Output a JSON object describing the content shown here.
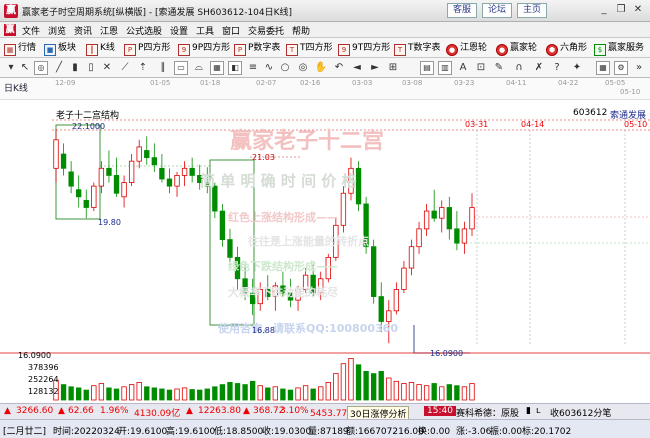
{
  "window": {
    "title": "赢家老子时空周期系统[纵横版] - [索通发展  SH603612-104日K线]",
    "buttons": [
      "客服",
      "论坛",
      "主页"
    ],
    "controls": [
      "minimize",
      "restore",
      "close"
    ]
  },
  "menu": {
    "items": [
      "文件",
      "浏览",
      "资讯",
      "江恩",
      "公式选股",
      "设置",
      "工具",
      "窗口",
      "交易委托",
      "帮助"
    ]
  },
  "toolbar1": {
    "items": [
      {
        "label": "行情",
        "icon": "grid-icon"
      },
      {
        "label": "板块",
        "icon": "block-icon"
      },
      {
        "label": "K线",
        "icon": "kline-icon"
      },
      {
        "label": "P四方形",
        "icon": "p-square-icon"
      },
      {
        "label": "9P四方形",
        "icon": "9p-square-icon"
      },
      {
        "label": "P数字表",
        "icon": "p-table-icon"
      },
      {
        "label": "T四方形",
        "icon": "t-square-icon"
      },
      {
        "label": "9T四方形",
        "icon": "9t-square-icon"
      },
      {
        "label": "T数字表",
        "icon": "t-table-icon"
      },
      {
        "label": "江恩轮",
        "icon": "gann-wheel-icon"
      },
      {
        "label": "赢家轮",
        "icon": "winner-wheel-icon"
      },
      {
        "label": "六角形",
        "icon": "hexagon-icon"
      },
      {
        "label": "赢家服务",
        "icon": "service-icon"
      }
    ]
  },
  "datebar": {
    "timeframe": "日K线",
    "dates": [
      "12-09",
      "01-05",
      "01-18",
      "02-07",
      "02-16",
      "03-03",
      "03-08",
      "03-23",
      "04-11",
      "04-22",
      "05-05",
      "05-10"
    ]
  },
  "chart": {
    "formula_name": "老子十二宫结构",
    "stock_code": "603612",
    "stock_name": "索通发展",
    "time_labels": [
      "03-31",
      "04-14",
      "05-10"
    ],
    "watermark_brand": "赢家老子十二宫",
    "watermark_motto": "简 单   明 确   时 间   价 格",
    "watermark_red": "红色上涨结构形成——",
    "watermark_red2": "往往是上涨能量的转折点",
    "watermark_green": "绿色下跌结构形成——",
    "watermark_green2": "大概率下跌动能的耗尽",
    "watermark_contact": "使用咨询，请联系QQ:100800360",
    "price_labels": [
      "22.1000",
      "19.80",
      "21.03",
      "16.88",
      "16.0900"
    ],
    "volume_axis": [
      "16.0900",
      "378396",
      "252264",
      "128132"
    ]
  },
  "chart_data": {
    "type": "candlestick",
    "candles": [
      [
        21.0,
        22.1,
        20.6,
        21.8
      ],
      [
        21.4,
        21.7,
        20.8,
        21.0
      ],
      [
        20.9,
        21.2,
        20.3,
        20.5
      ],
      [
        20.4,
        20.8,
        19.9,
        20.2
      ],
      [
        20.1,
        20.4,
        19.6,
        19.9
      ],
      [
        19.9,
        20.6,
        19.8,
        20.5
      ],
      [
        20.5,
        21.2,
        20.3,
        21.0
      ],
      [
        21.0,
        21.5,
        20.6,
        20.8
      ],
      [
        20.8,
        21.3,
        20.2,
        20.3
      ],
      [
        20.2,
        20.8,
        19.9,
        20.6
      ],
      [
        20.6,
        21.4,
        20.5,
        21.2
      ],
      [
        21.2,
        21.8,
        21.0,
        21.6
      ],
      [
        21.5,
        21.9,
        21.1,
        21.3
      ],
      [
        21.3,
        21.7,
        20.9,
        21.1
      ],
      [
        21.0,
        21.4,
        20.6,
        20.7
      ],
      [
        20.7,
        21.0,
        20.3,
        20.5
      ],
      [
        20.5,
        20.9,
        20.2,
        20.8
      ],
      [
        20.8,
        21.2,
        20.5,
        21.0
      ],
      [
        21.0,
        21.3,
        20.6,
        20.8
      ],
      [
        20.8,
        21.1,
        20.4,
        20.6
      ],
      [
        20.6,
        21.03,
        20.3,
        20.5
      ],
      [
        20.5,
        20.6,
        19.6,
        19.8
      ],
      [
        19.8,
        20.0,
        18.8,
        19.0
      ],
      [
        19.0,
        19.3,
        18.2,
        18.5
      ],
      [
        18.5,
        18.8,
        17.6,
        17.9
      ],
      [
        17.9,
        18.3,
        17.3,
        17.5
      ],
      [
        17.5,
        17.9,
        16.88,
        17.2
      ],
      [
        17.2,
        17.8,
        17.0,
        17.6
      ],
      [
        17.6,
        18.0,
        17.3,
        17.4
      ],
      [
        17.4,
        17.8,
        17.0,
        17.7
      ],
      [
        17.7,
        18.1,
        17.4,
        17.5
      ],
      [
        17.5,
        17.9,
        17.1,
        17.3
      ],
      [
        17.3,
        17.7,
        17.0,
        17.6
      ],
      [
        17.6,
        18.2,
        17.5,
        18.0
      ],
      [
        18.0,
        18.3,
        17.4,
        17.5
      ],
      [
        17.5,
        18.1,
        17.3,
        17.9
      ],
      [
        17.9,
        18.6,
        17.8,
        18.5
      ],
      [
        18.5,
        19.6,
        18.4,
        19.4
      ],
      [
        19.4,
        20.5,
        19.2,
        20.3
      ],
      [
        20.3,
        21.3,
        20.1,
        21.0
      ],
      [
        21.0,
        21.2,
        19.8,
        20.0
      ],
      [
        20.0,
        20.2,
        18.6,
        18.8
      ],
      [
        18.8,
        19.0,
        17.2,
        17.4
      ],
      [
        17.4,
        17.8,
        16.4,
        16.7
      ],
      [
        16.7,
        17.3,
        16.09,
        17.0
      ],
      [
        17.0,
        17.8,
        16.9,
        17.6
      ],
      [
        17.6,
        18.4,
        17.5,
        18.2
      ],
      [
        18.2,
        19.0,
        18.0,
        18.8
      ],
      [
        18.8,
        19.5,
        18.6,
        19.3
      ],
      [
        19.3,
        20.0,
        19.1,
        19.8
      ],
      [
        19.8,
        20.4,
        19.5,
        19.6
      ],
      [
        19.6,
        20.1,
        19.2,
        19.9
      ],
      [
        19.9,
        20.2,
        19.0,
        19.3
      ],
      [
        19.3,
        19.8,
        18.7,
        18.9
      ],
      [
        18.9,
        19.5,
        18.6,
        19.3
      ],
      [
        19.3,
        20.3,
        19.1,
        19.9
      ]
    ],
    "volume": [
      180,
      140,
      120,
      110,
      90,
      130,
      150,
      110,
      100,
      120,
      140,
      160,
      120,
      110,
      100,
      90,
      100,
      110,
      95,
      90,
      100,
      120,
      140,
      160,
      150,
      140,
      170,
      130,
      110,
      120,
      100,
      90,
      110,
      130,
      100,
      120,
      160,
      240,
      330,
      378,
      320,
      260,
      240,
      260,
      200,
      170,
      150,
      160,
      140,
      130,
      150,
      120,
      140,
      130,
      120,
      150
    ]
  },
  "status1": {
    "sh_index": "3266.60",
    "sh_change": "62.66",
    "sh_pct": "1.96%",
    "sh_amount": "4130.09亿",
    "sz_index": "12263.80",
    "sz_change": "368.72",
    "sz_pct": "3.10%",
    "sz_amount": "5453.77亿",
    "ticker1": "30日涨停分析",
    "ticker_time": "15:40",
    "ticker2": "赛科希德：原股",
    "fav": "收603612分笔"
  },
  "status2": {
    "date_tag": "[二月廿二]",
    "time": "时间:20220324",
    "open": "开:19.6100",
    "high": "高:19.6100",
    "low": "低:18.8500",
    "close": "收:19.0300",
    "volume": "量:87189",
    "amount": "额:166707216.00",
    "turnover": "换:0.00",
    "change": "涨:-3.06",
    "amplitude": "振:0.00",
    "scale": "标:20.1702"
  }
}
